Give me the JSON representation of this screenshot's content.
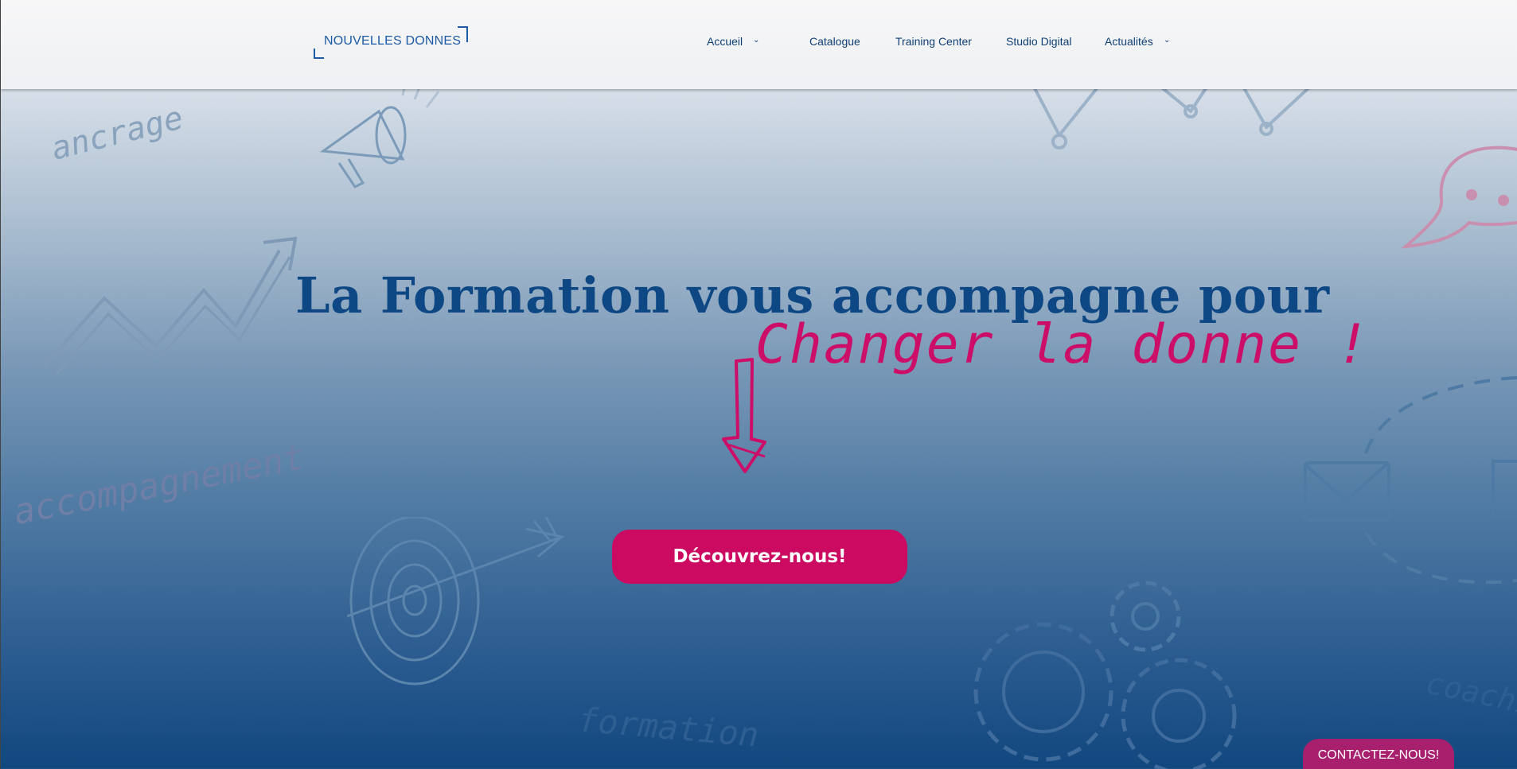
{
  "header": {
    "logo_text": "NOUVELLES DONNES",
    "nav": [
      {
        "label": "Accueil",
        "chevron": true
      },
      {
        "label": "Catalogue",
        "chevron": false
      },
      {
        "label": "Training Center",
        "chevron": false
      },
      {
        "label": "Studio Digital",
        "chevron": false
      },
      {
        "label": "Actualités",
        "chevron": true
      }
    ]
  },
  "hero": {
    "title": "La Formation vous accompagne pour",
    "subtitle": "Changer la donne !",
    "cta_label": "Découvrez-nous!"
  },
  "background_words": {
    "w1": "ancrage",
    "w2": "accompagnement",
    "w3": "formation",
    "w4": "coachi"
  },
  "contact_label": "CONTACTEZ-NOUS!",
  "colors": {
    "brand_blue": "#0d4784",
    "accent_pink": "#cc0a62",
    "contact_bg": "#a8206d"
  },
  "icons": [
    "megaphone-icon",
    "trend-arrow-icon",
    "target-icon",
    "gears-icon",
    "chat-bubble-icon",
    "envelope-icon",
    "line-graph-icon",
    "down-arrow-icon"
  ]
}
